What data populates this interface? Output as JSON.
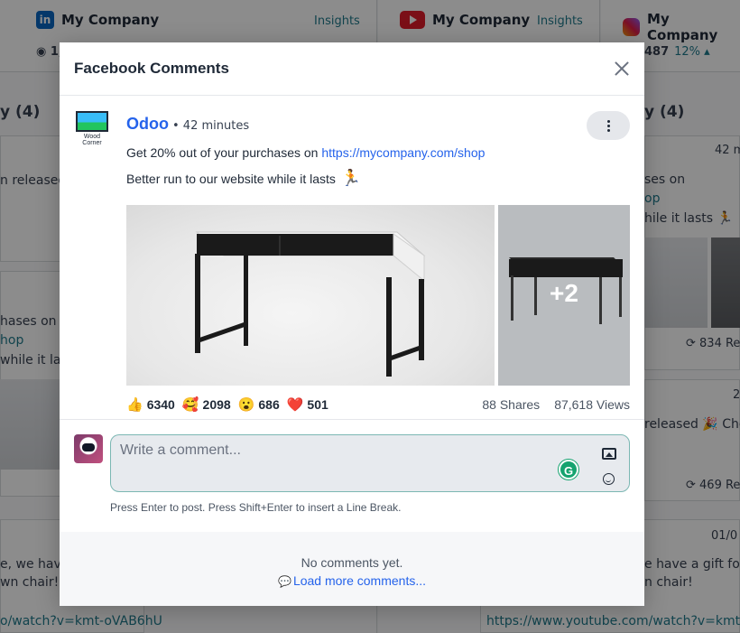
{
  "stream": {
    "columns": [
      {
        "account": "My Company",
        "network": "linkedin-icon",
        "insights": "Insights",
        "stat": "1,",
        "pct": ""
      },
      {
        "account": "My Company",
        "network": "youtube-icon",
        "insights": "Insights",
        "stat": "",
        "pct": ""
      },
      {
        "account": "My Company",
        "network": "instagram-icon",
        "insights": "",
        "stat": "487",
        "pct": "12% ▴"
      }
    ],
    "bg_texts": {
      "title_left": "y (4)",
      "title_right": "y (4)",
      "released_left": "n released",
      "time_right": "42 m",
      "purch_right": "ses on",
      "shop_right": "op",
      "lasts_right": "hile it lasts 🏃",
      "purch_left": "hases on",
      "shop_left": "hop",
      "lasts_left": "while it las",
      "shares_right": "834 Re",
      "num2_right": "2",
      "released_right": "released 🎉 Chec",
      "shares2_right": "469 Re",
      "date_right": "01/0",
      "gift_left": "e, we have a",
      "chair_left": "wn chair!",
      "link_left": "o/watch?v=kmt-oVAB6hU",
      "gift_right": "e have a gift for",
      "chair_right": "n chair!",
      "link_right": "https://www.youtube.com/watch?v=kmt-oVA"
    }
  },
  "modal": {
    "title": "Facebook Comments",
    "post": {
      "page_caption": "Wood Corner",
      "author": "Odoo",
      "time": "• 42 minutes",
      "line1_text": "Get 20% out of your purchases on ",
      "line1_link": "https://mycompany.com/shop",
      "line2_text": "Better run to our website while it lasts",
      "line2_emoji": "🏃",
      "more_images": "+2",
      "reactions": [
        {
          "icon": "👍",
          "count": "6340"
        },
        {
          "icon": "🥰",
          "count": "2098"
        },
        {
          "icon": "😮",
          "count": "686"
        },
        {
          "icon": "❤️",
          "count": "501"
        }
      ],
      "shares": "88 Shares",
      "views": "87,618 Views"
    },
    "comment_form": {
      "placeholder": "Write a comment...",
      "grammarly": "G",
      "hint": "Press Enter to post. Press Shift+Enter to insert a Line Break."
    },
    "comments": {
      "empty": "No comments yet.",
      "load_more": "Load more comments..."
    }
  },
  "colors": {
    "link": "#2563eb",
    "accent": "#1f7a8c",
    "input_border": "#7cb7b3"
  }
}
